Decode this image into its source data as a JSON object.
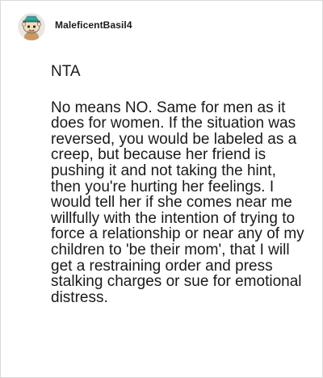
{
  "comment": {
    "username": "MaleficentBasil4",
    "paragraphs": [
      "NTA",
      "No means NO. Same for men as it does for women. If the situation was reversed, you would be labeled as a creep, but because her friend is pushing it and not taking the hint, then you're hurting her feelings. I would tell her if she comes near me willfully with the intention of trying to force a relationship or near any of my children to 'be their mom', that I will get a restraining order and press stalking charges or sue for emotional distress."
    ]
  },
  "icons": {
    "avatar": "snoo-avatar-icon"
  },
  "colors": {
    "text": "#1a1a1a",
    "border": "#d9d9d9",
    "avatar_bg": "#e9e7e2",
    "avatar_face": "#f4dcc2",
    "avatar_hat": "#3aa39a"
  }
}
